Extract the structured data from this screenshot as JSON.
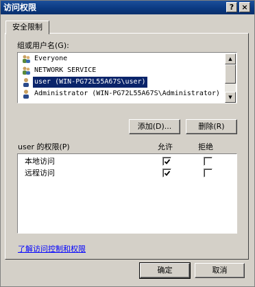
{
  "window": {
    "title": "访问权限",
    "help_button": "?",
    "close_button": "×"
  },
  "tabs": [
    {
      "label": "安全限制",
      "active": true
    }
  ],
  "users": {
    "label": "组或用户名(G):",
    "items": [
      {
        "name": "Everyone",
        "icon": "group-icon",
        "selected": false
      },
      {
        "name": "NETWORK SERVICE",
        "icon": "group-icon",
        "selected": false
      },
      {
        "name": "user (WIN-PG72L55A67S\\user)",
        "icon": "user-icon",
        "selected": true
      },
      {
        "name": "Administrator (WIN-PG72L55A67S\\Administrator)",
        "icon": "user-icon",
        "selected": false
      }
    ],
    "add_button": "添加(D)...",
    "remove_button": "删除(R)"
  },
  "permissions": {
    "title": "user 的权限(P)",
    "allow_header": "允许",
    "deny_header": "拒绝",
    "rows": [
      {
        "name": "本地访问",
        "allow": true,
        "deny": false
      },
      {
        "name": "远程访问",
        "allow": true,
        "deny": false
      }
    ]
  },
  "link": "了解访问控制和权限",
  "footer": {
    "ok_button": "确定",
    "cancel_button": "取消"
  },
  "colors": {
    "titlebar": "#0b3a82",
    "selection": "#0a246a",
    "face": "#d4d0c8",
    "link": "#0000ff"
  }
}
